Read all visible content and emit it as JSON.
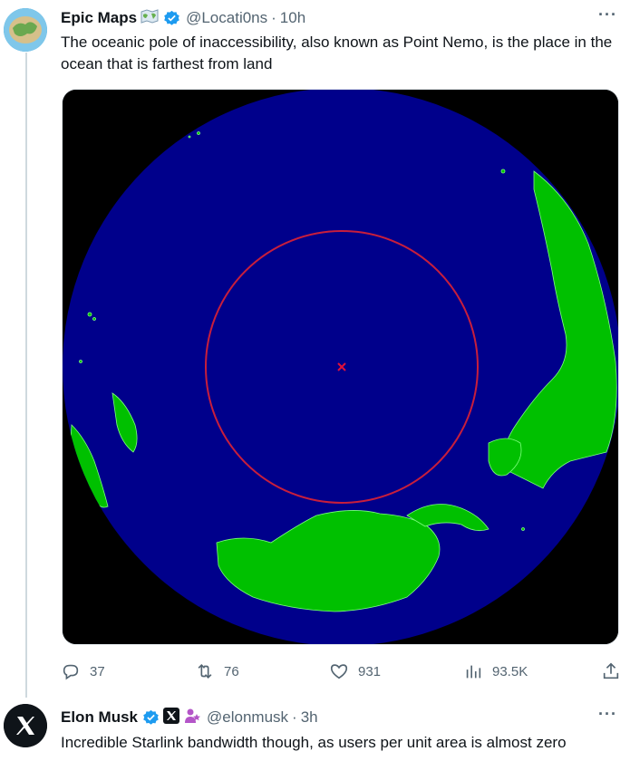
{
  "tweet1": {
    "author_name": "Epic Maps",
    "handle": "@Locati0ns",
    "separator": "·",
    "time": "10h",
    "more_label": "···",
    "text": "The oceanic pole of inaccessibility, also known as Point Nemo, is the place in the ocean that is farthest from land",
    "media": {
      "icons": [
        "map-emoji-icon",
        "verified-badge-icon"
      ],
      "globe_color": "#00008b",
      "land_color": "#00c800",
      "circle_color": "#c81e3c",
      "marker": "x"
    },
    "actions": {
      "replies": "37",
      "reposts": "76",
      "likes": "931",
      "views": "93.5K"
    }
  },
  "tweet2": {
    "author_name": "Elon Musk",
    "handle": "@elonmusk",
    "separator": "·",
    "time": "3h",
    "more_label": "···",
    "text": "Incredible Starlink bandwidth though, as users per unit area is almost zero",
    "icons": [
      "x-logo-icon",
      "verified-badge-icon",
      "x-affiliate-badge-icon",
      "person-emoji-icon"
    ]
  }
}
